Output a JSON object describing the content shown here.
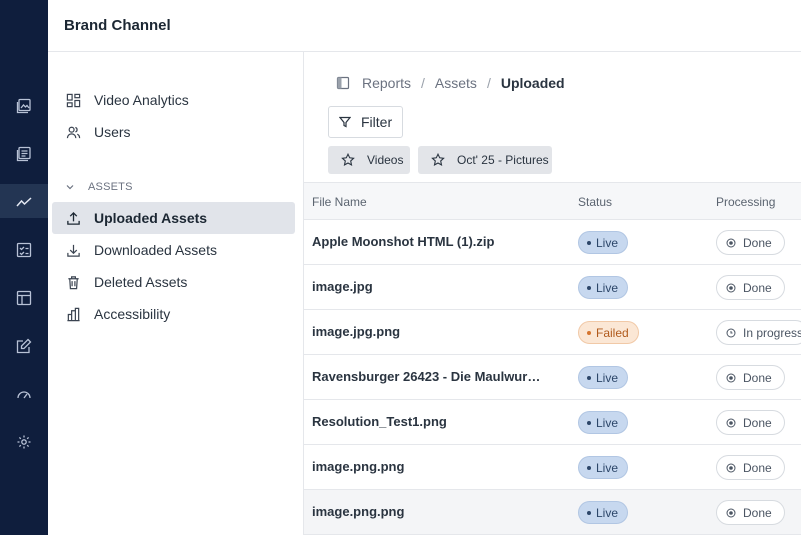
{
  "header": {
    "title": "Brand Channel"
  },
  "rail": {
    "icons": [
      "media-icon",
      "documents-icon",
      "analytics-icon",
      "report-icon",
      "layout-icon",
      "edit-icon",
      "dashboard-icon",
      "settings-icon"
    ],
    "active": "analytics-icon"
  },
  "subnav": {
    "items": [
      {
        "label": "Video Analytics",
        "icon": "grid-icon"
      },
      {
        "label": "Users",
        "icon": "users-icon"
      }
    ],
    "section": {
      "label": "ASSETS"
    },
    "section_items": [
      {
        "label": "Uploaded Assets",
        "icon": "upload-icon",
        "active": true
      },
      {
        "label": "Downloaded Assets",
        "icon": "download-icon"
      },
      {
        "label": "Deleted Assets",
        "icon": "trash-icon"
      },
      {
        "label": "Accessibility",
        "icon": "accessibility-icon"
      }
    ]
  },
  "breadcrumb": {
    "items": [
      "Reports",
      "Assets",
      "Uploaded"
    ],
    "separator": "/"
  },
  "toolbar": {
    "filter_label": "Filter"
  },
  "chips": [
    {
      "label": "Videos",
      "icon": "star-icon"
    },
    {
      "label": "Oct' 25 - Pictures",
      "icon": "star-icon"
    }
  ],
  "table": {
    "columns": [
      "File Name",
      "Status",
      "Processing"
    ],
    "rows": [
      {
        "name": "Apple Moonshot HTML (1).zip",
        "status": "Live",
        "processing": "Done"
      },
      {
        "name": "image.jpg",
        "status": "Live",
        "processing": "Done"
      },
      {
        "name": "image.jpg.png",
        "status": "Failed",
        "processing": "In progress"
      },
      {
        "name": "Ravensburger 26423 - Die Maulwurf ...",
        "status": "Live",
        "processing": "Done"
      },
      {
        "name": "Resolution_Test1.png",
        "status": "Live",
        "processing": "Done"
      },
      {
        "name": "image.png.png",
        "status": "Live",
        "processing": "Done"
      },
      {
        "name": "image.png.png",
        "status": "Live",
        "processing": "Done"
      }
    ]
  },
  "colors": {
    "rail_bg": "#0f1e3d",
    "live_badge": "#c7d8ef",
    "failed_badge": "#fbe7d5",
    "active_nav": "#e1e4ea"
  }
}
